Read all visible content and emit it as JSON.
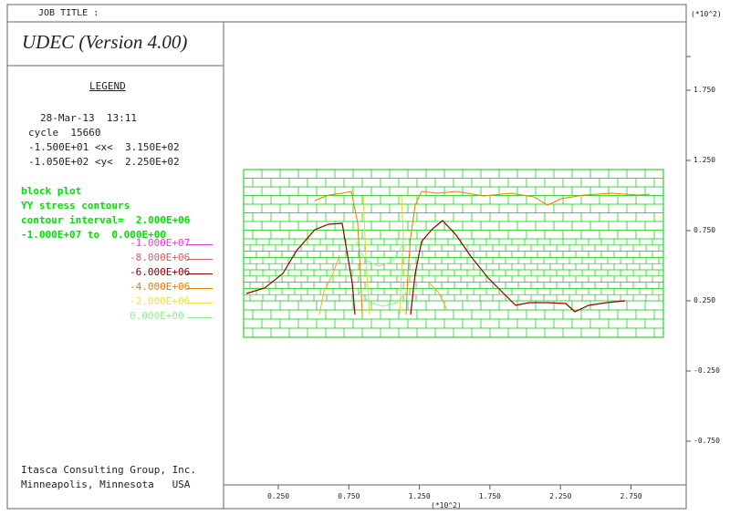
{
  "job_title_label": "JOB TITLE :",
  "app_title": "UDEC (Version 4.00)",
  "legend_heading": "LEGEND",
  "run_info": {
    "timestamp": "28-Mar-13  13:11",
    "cycle": "cycle  15660",
    "x_range": "-1.500E+01 <x<  3.150E+02",
    "y_range": "-1.050E+02 <y<  2.250E+02"
  },
  "plot_info": {
    "plot_type": "block plot",
    "contour_type": "YY stress contours",
    "contour_interval": "contour interval=  2.000E+06",
    "contour_range": "-1.000E+07 to  0.000E+00"
  },
  "contour_levels": [
    {
      "label": "-1.000E+07",
      "color": "#e040e0"
    },
    {
      "label": "-8.000E+06",
      "color": "#d06060"
    },
    {
      "label": "-6.000E+06",
      "color": "#800000"
    },
    {
      "label": "-4.000E+06",
      "color": "#e08000"
    },
    {
      "label": "-2.000E+06",
      "color": "#f0e040"
    },
    {
      "label": "0.000E+00",
      "color": "#90f090"
    }
  ],
  "credits": {
    "line1": "Itasca Consulting Group, Inc.",
    "line2": "Minneapolis, Minnesota   USA"
  },
  "axes": {
    "x_multiplier": "(*10^2)",
    "y_multiplier": "(*10^2)",
    "x_ticks": [
      "0.250",
      "0.750",
      "1.250",
      "1.750",
      "2.250",
      "2.750"
    ],
    "y_ticks": [
      "1.750",
      "1.250",
      "0.750",
      "0.250",
      "-0.250",
      "-0.750"
    ]
  },
  "colors": {
    "block": "#00cc00",
    "frame": "#555555"
  }
}
